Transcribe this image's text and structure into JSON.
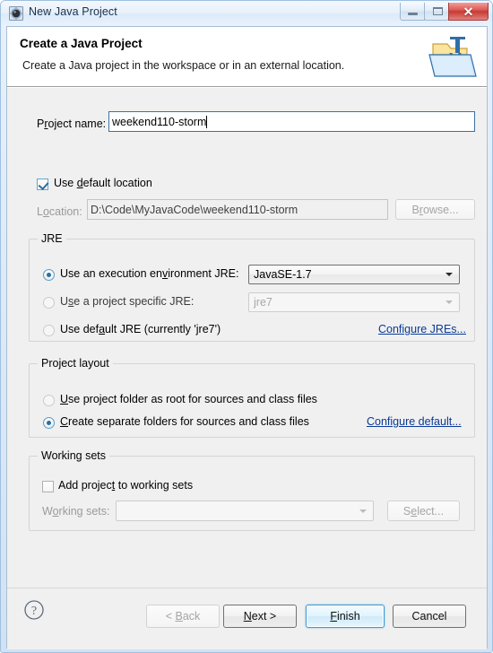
{
  "window": {
    "title": "New Java Project",
    "icon": "eclipse-gear-icon",
    "controls": {
      "minimize": "Minimize",
      "maximize": "Maximize",
      "close": "Close",
      "close_glyph": "✕"
    }
  },
  "header": {
    "title": "Create a Java Project",
    "subtitle": "Create a Java project in the workspace or in an external location.",
    "icon": "java-project-folder-icon"
  },
  "form": {
    "project_name": {
      "label": "Project name:",
      "label_pre": "P",
      "label_mnemonic": "r",
      "label_post": "oject name:",
      "value": "weekend110-storm",
      "placeholder": ""
    },
    "use_default_location": {
      "label_pre": "Use ",
      "label_mnemonic": "d",
      "label_post": "efault location",
      "checked": true
    },
    "location": {
      "label_pre": "L",
      "label_mnemonic": "o",
      "label_post": "cation:",
      "value": "D:\\Code\\MyJavaCode\\weekend110-storm",
      "enabled": false
    },
    "browse_button": {
      "label_pre": "B",
      "label_mnemonic": "r",
      "label_post": "owse...",
      "enabled": false
    }
  },
  "jre": {
    "group_title": "JRE",
    "options": [
      {
        "label_pre": "Use an execution en",
        "label_mnemonic": "v",
        "label_post": "ironment JRE:",
        "selected": true
      },
      {
        "label_pre": "U",
        "label_mnemonic": "s",
        "label_post": "e a project specific JRE:",
        "selected": false
      },
      {
        "label_pre": "Use def",
        "label_mnemonic": "a",
        "label_post": "ult JRE (currently 'jre7')",
        "selected": false
      }
    ],
    "execution_env_value": "JavaSE-1.7",
    "project_jre_value": "jre7",
    "configure_link": "Configure JREs..."
  },
  "project_layout": {
    "group_title": "Project layout",
    "options": [
      {
        "label_pre": "",
        "label_mnemonic": "U",
        "label_post": "se project folder as root for sources and class files",
        "selected": false
      },
      {
        "label_pre": "",
        "label_mnemonic": "C",
        "label_post": "reate separate folders for sources and class files",
        "selected": true
      }
    ],
    "configure_link": "Configure default..."
  },
  "working_sets": {
    "group_title": "Working sets",
    "add_checkbox": {
      "label_pre": "Add projec",
      "label_mnemonic": "t",
      "label_post": " to working sets",
      "checked": false
    },
    "field_label_pre": "W",
    "field_label_mnemonic": "o",
    "field_label_post": "rking sets:",
    "field_value": "",
    "select_button": {
      "label_pre": "S",
      "label_mnemonic": "e",
      "label_post": "lect...",
      "enabled": false
    }
  },
  "footer": {
    "help_icon": "help-question-icon",
    "back": {
      "label_pre": "< ",
      "label_mnemonic": "B",
      "label_post": "ack",
      "enabled": false
    },
    "next": {
      "label_pre": "",
      "label_mnemonic": "N",
      "label_post": "ext >",
      "enabled": true
    },
    "finish": {
      "label_pre": "",
      "label_mnemonic": "F",
      "label_post": "inish",
      "enabled": true,
      "is_default": true
    },
    "cancel": {
      "label": "Cancel",
      "enabled": true
    }
  },
  "colors": {
    "accent": "#3c9dd4",
    "link": "#0a3a96",
    "titlebar_text": "#17314f",
    "close_button": "#c63a34",
    "body_bg": "#f0f0f0"
  }
}
